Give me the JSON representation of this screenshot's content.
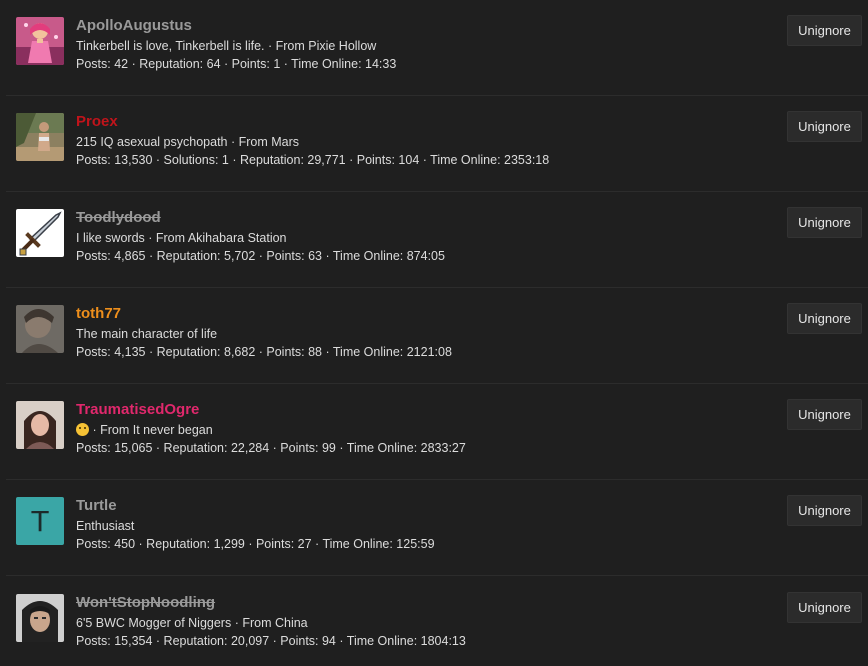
{
  "colors": {
    "background": "#1f1f1f",
    "grey_user": "#9a9a9a",
    "red_user": "#c0141b",
    "orange_user": "#ee8f1c",
    "pink_user": "#e0286c",
    "teal_avatar": "#3aa6a6"
  },
  "users": [
    {
      "name": "ApolloAugustus",
      "color": "#9a9a9a",
      "struck": false,
      "avatar": "pink-character-avatar",
      "emoji": false,
      "meta": "Tinkerbell is love, Tinkerbell is life. · From Pixie Hollow",
      "stats": "Posts: 42 · Reputation: 64 · Points: 1 · Time Online: 14:33",
      "button": "Unignore"
    },
    {
      "name": "Proex",
      "color": "#c0141b",
      "struck": false,
      "avatar": "beach-photo-avatar",
      "emoji": false,
      "meta": "215 IQ asexual psychopath · From Mars",
      "stats": "Posts: 13,530 · Solutions: 1 · Reputation: 29,771 · Points: 104 · Time Online: 2353:18",
      "button": "Unignore"
    },
    {
      "name": "Toodlydood",
      "color": "#9a9a9a",
      "struck": true,
      "avatar": "sword-avatar",
      "emoji": false,
      "meta": "I like swords · From Akihabara Station",
      "stats": "Posts: 4,865 · Reputation: 5,702 · Points: 63 · Time Online: 874:05",
      "button": "Unignore"
    },
    {
      "name": "toth77",
      "color": "#ee8f1c",
      "struck": false,
      "avatar": "blurry-face-avatar",
      "emoji": false,
      "meta": "The main character of life",
      "stats": "Posts: 4,135 · Reputation: 8,682 · Points: 88 · Time Online: 2121:08",
      "button": "Unignore"
    },
    {
      "name": "TraumatisedOgre",
      "color": "#e0286c",
      "struck": false,
      "avatar": "portrait-avatar",
      "emoji": true,
      "meta": "· From It never began",
      "stats": "Posts: 15,065 · Reputation: 22,284 · Points: 99 · Time Online: 2833:27",
      "button": "Unignore"
    },
    {
      "name": "Turtle",
      "color": "#9a9a9a",
      "struck": false,
      "avatar": "letter-avatar",
      "avatar_letter": "T",
      "emoji": false,
      "meta": "Enthusiast",
      "stats": "Posts: 450 · Reputation: 1,299 · Points: 27 · Time Online: 125:59",
      "button": "Unignore"
    },
    {
      "name": "Won'tStopNoodling",
      "color": "#9a9a9a",
      "struck": true,
      "avatar": "selfie-avatar",
      "emoji": false,
      "meta": "6'5 BWC Mogger of Niggers · From China",
      "stats": "Posts: 15,354 · Reputation: 20,097 · Points: 94 · Time Online: 1804:13",
      "button": "Unignore"
    }
  ]
}
